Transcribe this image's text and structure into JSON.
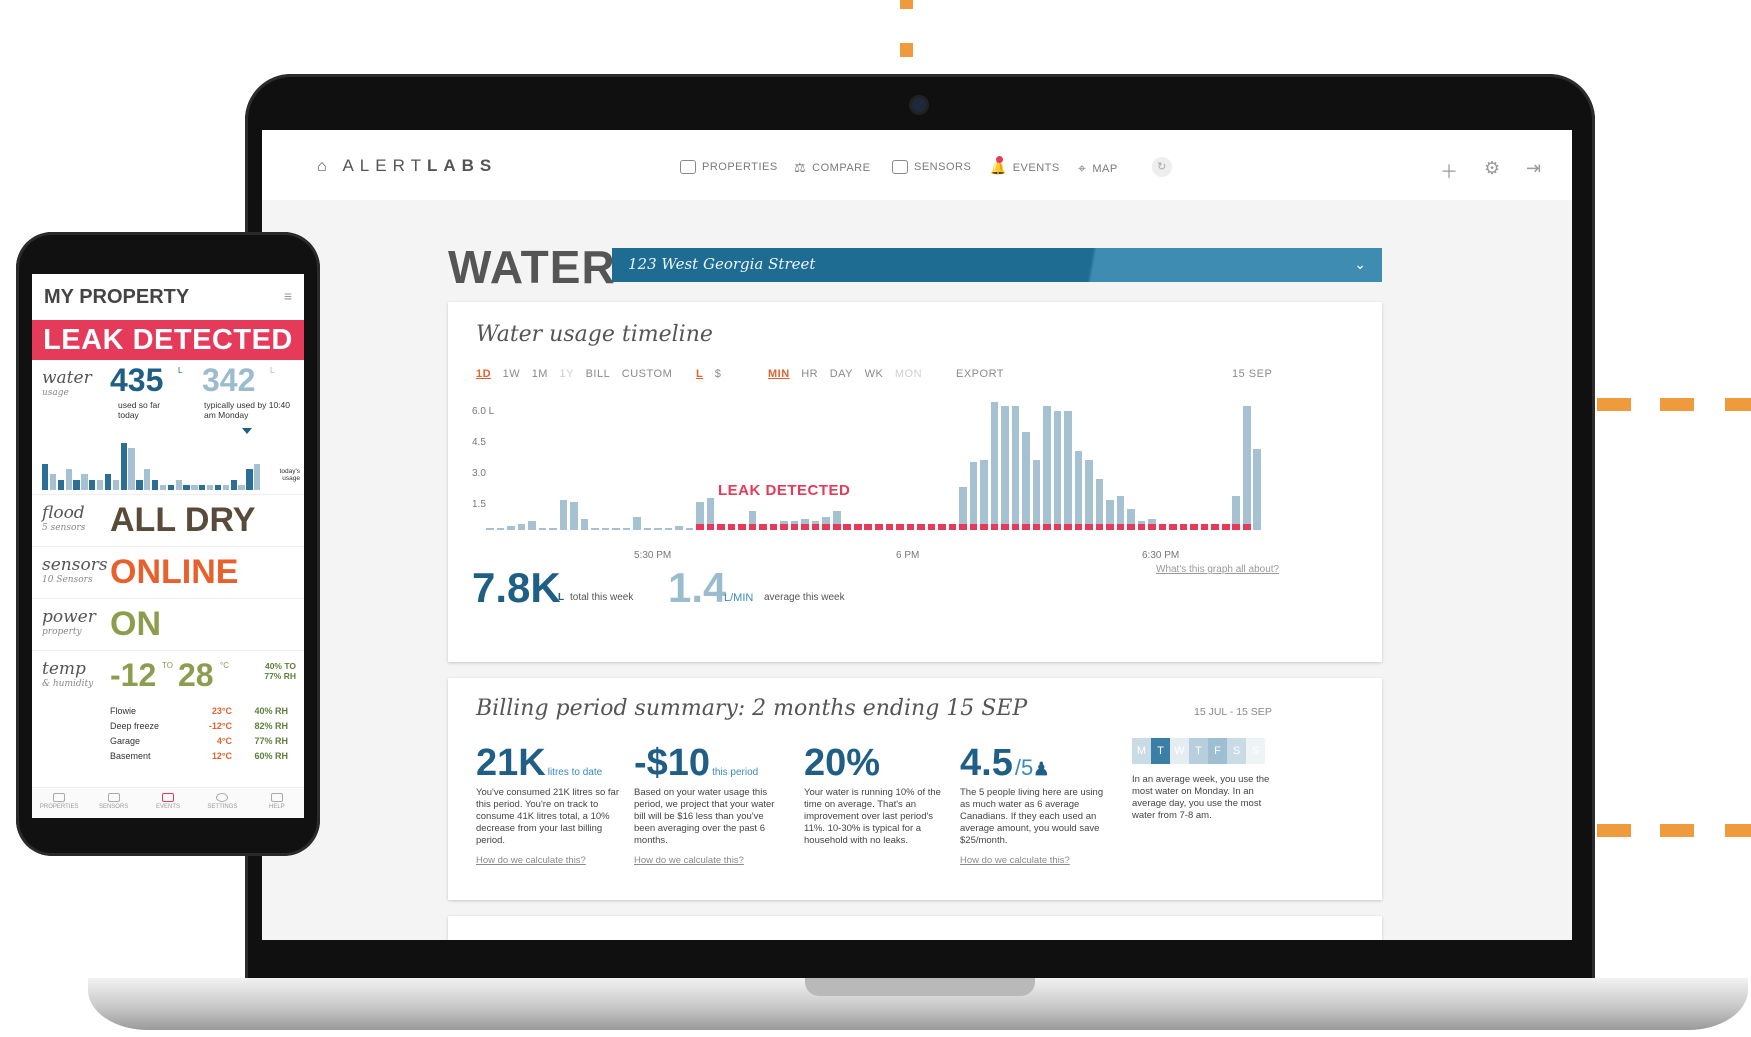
{
  "brand": {
    "name_light": "ALERT",
    "name_bold": "LABS"
  },
  "nav": {
    "items": [
      {
        "label": "PROPERTIES",
        "icon": "house-icon"
      },
      {
        "label": "COMPARE",
        "icon": "compare-icon"
      },
      {
        "label": "SENSORS",
        "icon": "sensor-icon"
      },
      {
        "label": "EVENTS",
        "icon": "bell-icon"
      },
      {
        "label": "MAP",
        "icon": "map-pin-icon"
      }
    ],
    "right_icons": [
      "plus-icon",
      "gear-icon",
      "logout-icon"
    ]
  },
  "page": {
    "title": "WATER",
    "address": "123 West Georgia Street"
  },
  "timeline": {
    "title": "Water usage timeline",
    "ranges": [
      "1D",
      "1W",
      "1M",
      "1Y",
      "BILL",
      "CUSTOM"
    ],
    "units": [
      "L",
      "$"
    ],
    "resolution": [
      "MIN",
      "HR",
      "DAY",
      "WK",
      "MON"
    ],
    "export": "EXPORT",
    "date": "15 SEP",
    "leak_label": "LEAK DETECTED",
    "help_link": "What's this graph all about?",
    "total": "7.8K",
    "total_unit": "L",
    "total_caption": "total this week",
    "avg": "1.4",
    "avg_unit": "L/MIN",
    "avg_caption": "average this week"
  },
  "chart_data": {
    "type": "bar",
    "ylabel_unit": "L",
    "yticks": [
      "6.0 L",
      "4.5",
      "3.0",
      "1.5"
    ],
    "ylim": [
      0,
      6.0
    ],
    "xticks": [
      "5:30 PM",
      "6 PM",
      "6:30 PM"
    ],
    "values": [
      0.1,
      0.1,
      0.2,
      0.3,
      0.4,
      0.1,
      0.1,
      1.4,
      1.3,
      0.5,
      0.1,
      0.1,
      0.1,
      0.1,
      0.6,
      0.1,
      0.1,
      0.1,
      0.2,
      0.1,
      1.3,
      1.5,
      0.2,
      0.3,
      0.2,
      0.9,
      0.3,
      0.2,
      0.4,
      0.4,
      0.5,
      0.4,
      0.6,
      0.9,
      0.3,
      0.2,
      0.3,
      0.3,
      0.3,
      0.2,
      0.3,
      0.2,
      0.2,
      0.3,
      0.3,
      2.0,
      3.2,
      3.3,
      6.0,
      5.8,
      5.8,
      4.6,
      3.3,
      5.8,
      5.6,
      5.6,
      3.7,
      3.3,
      2.4,
      1.4,
      1.6,
      1.0,
      0.4,
      0.5,
      0.3,
      0.2,
      0.3,
      0.1,
      0.1,
      0.1,
      0.2,
      1.6,
      5.8,
      3.8
    ],
    "leak_start_index": 20,
    "leak_color": "#e53a5a",
    "bar_color": "#a6c2d2"
  },
  "billing": {
    "title": "Billing period summary: 2 months ending 15 SEP",
    "range": "15 JUL - 15 SEP",
    "cols": [
      {
        "big": "21K",
        "unit": "litres to date",
        "text": "You've consumed 21K litres so far this period. You're on track to consume 41K litres total, a 10% decrease from your last billing period.",
        "link": "How do we calculate this?"
      },
      {
        "big": "-$10",
        "unit": "this period",
        "text": "Based on your water usage this period, we project that your water bill will be $16 less than you've been averaging over the past 6 months.",
        "link": "How do we calculate this?"
      },
      {
        "big": "20%",
        "unit": "",
        "text": "Your water is running 10% of the time on average. That's an improvement over last period's 11%. 10-30% is typical for a household with no leaks.",
        "link": ""
      },
      {
        "big": "4.5",
        "unit": "/5",
        "text": "The 5 people living here are using as much water as 6 average Canadians. If they each used an average amount, you would save $25/month.",
        "link": "How do we calculate this?"
      },
      {
        "big": "",
        "unit": "",
        "text": "In an average week, you use the most water on Monday. In an average day, you use the most water from 7-8 am.",
        "link": ""
      }
    ],
    "days": [
      "M",
      "T",
      "W",
      "T",
      "F",
      "S",
      "S"
    ]
  },
  "phone": {
    "title": "MY PROPERTY",
    "alert": "LEAK DETECTED",
    "water": {
      "label": "water",
      "sub": "usage",
      "used": "435",
      "used_unit": "L",
      "used_caption": "used so far today",
      "typical": "342",
      "typical_unit": "L",
      "typical_caption": "typically used by 10:40 am Monday",
      "bar_caption": "today's usage"
    },
    "flood": {
      "label": "flood",
      "sub": "5 sensors",
      "status": "ALL DRY"
    },
    "sensors": {
      "label": "sensors",
      "sub": "10 Sensors",
      "status": "ONLINE"
    },
    "power": {
      "label": "power",
      "sub": "property",
      "status": "ON"
    },
    "temp": {
      "label": "temp",
      "sub": "& humidity",
      "low": "-12",
      "to": "TO",
      "high": "28",
      "unit": "°C",
      "rh": "40% TO 77% RH"
    },
    "rooms": [
      {
        "name": "Flowie",
        "temp": "23°C",
        "rh": "40% RH"
      },
      {
        "name": "Deep freeze",
        "temp": "-12°C",
        "rh": "82% RH"
      },
      {
        "name": "Garage",
        "temp": "4°C",
        "rh": "77% RH"
      },
      {
        "name": "Basement",
        "temp": "12°C",
        "rh": "60% RH"
      }
    ],
    "tabs": [
      "PROPERTIES",
      "SENSORS",
      "EVENTS",
      "SETTINGS",
      "HELP"
    ],
    "water_bars": [
      0.5,
      0.3,
      0.2,
      0.4,
      0.2,
      0.3,
      0.2,
      0.2,
      0.3,
      0.2,
      0.9,
      0.8,
      0.2,
      0.4,
      0.2,
      0.1,
      0.1,
      0.2,
      0.1,
      0.1,
      0.1,
      0.1,
      0.1,
      0.1,
      0.2,
      0.1,
      0.4,
      0.5
    ]
  },
  "colors": {
    "accent_orange": "#ef9a3c",
    "blue": "#1f6c93",
    "leak_red": "#e53a5a",
    "status_brown": "#5a4a3a",
    "status_orange": "#e8612c",
    "status_green": "#8c9d4e"
  }
}
